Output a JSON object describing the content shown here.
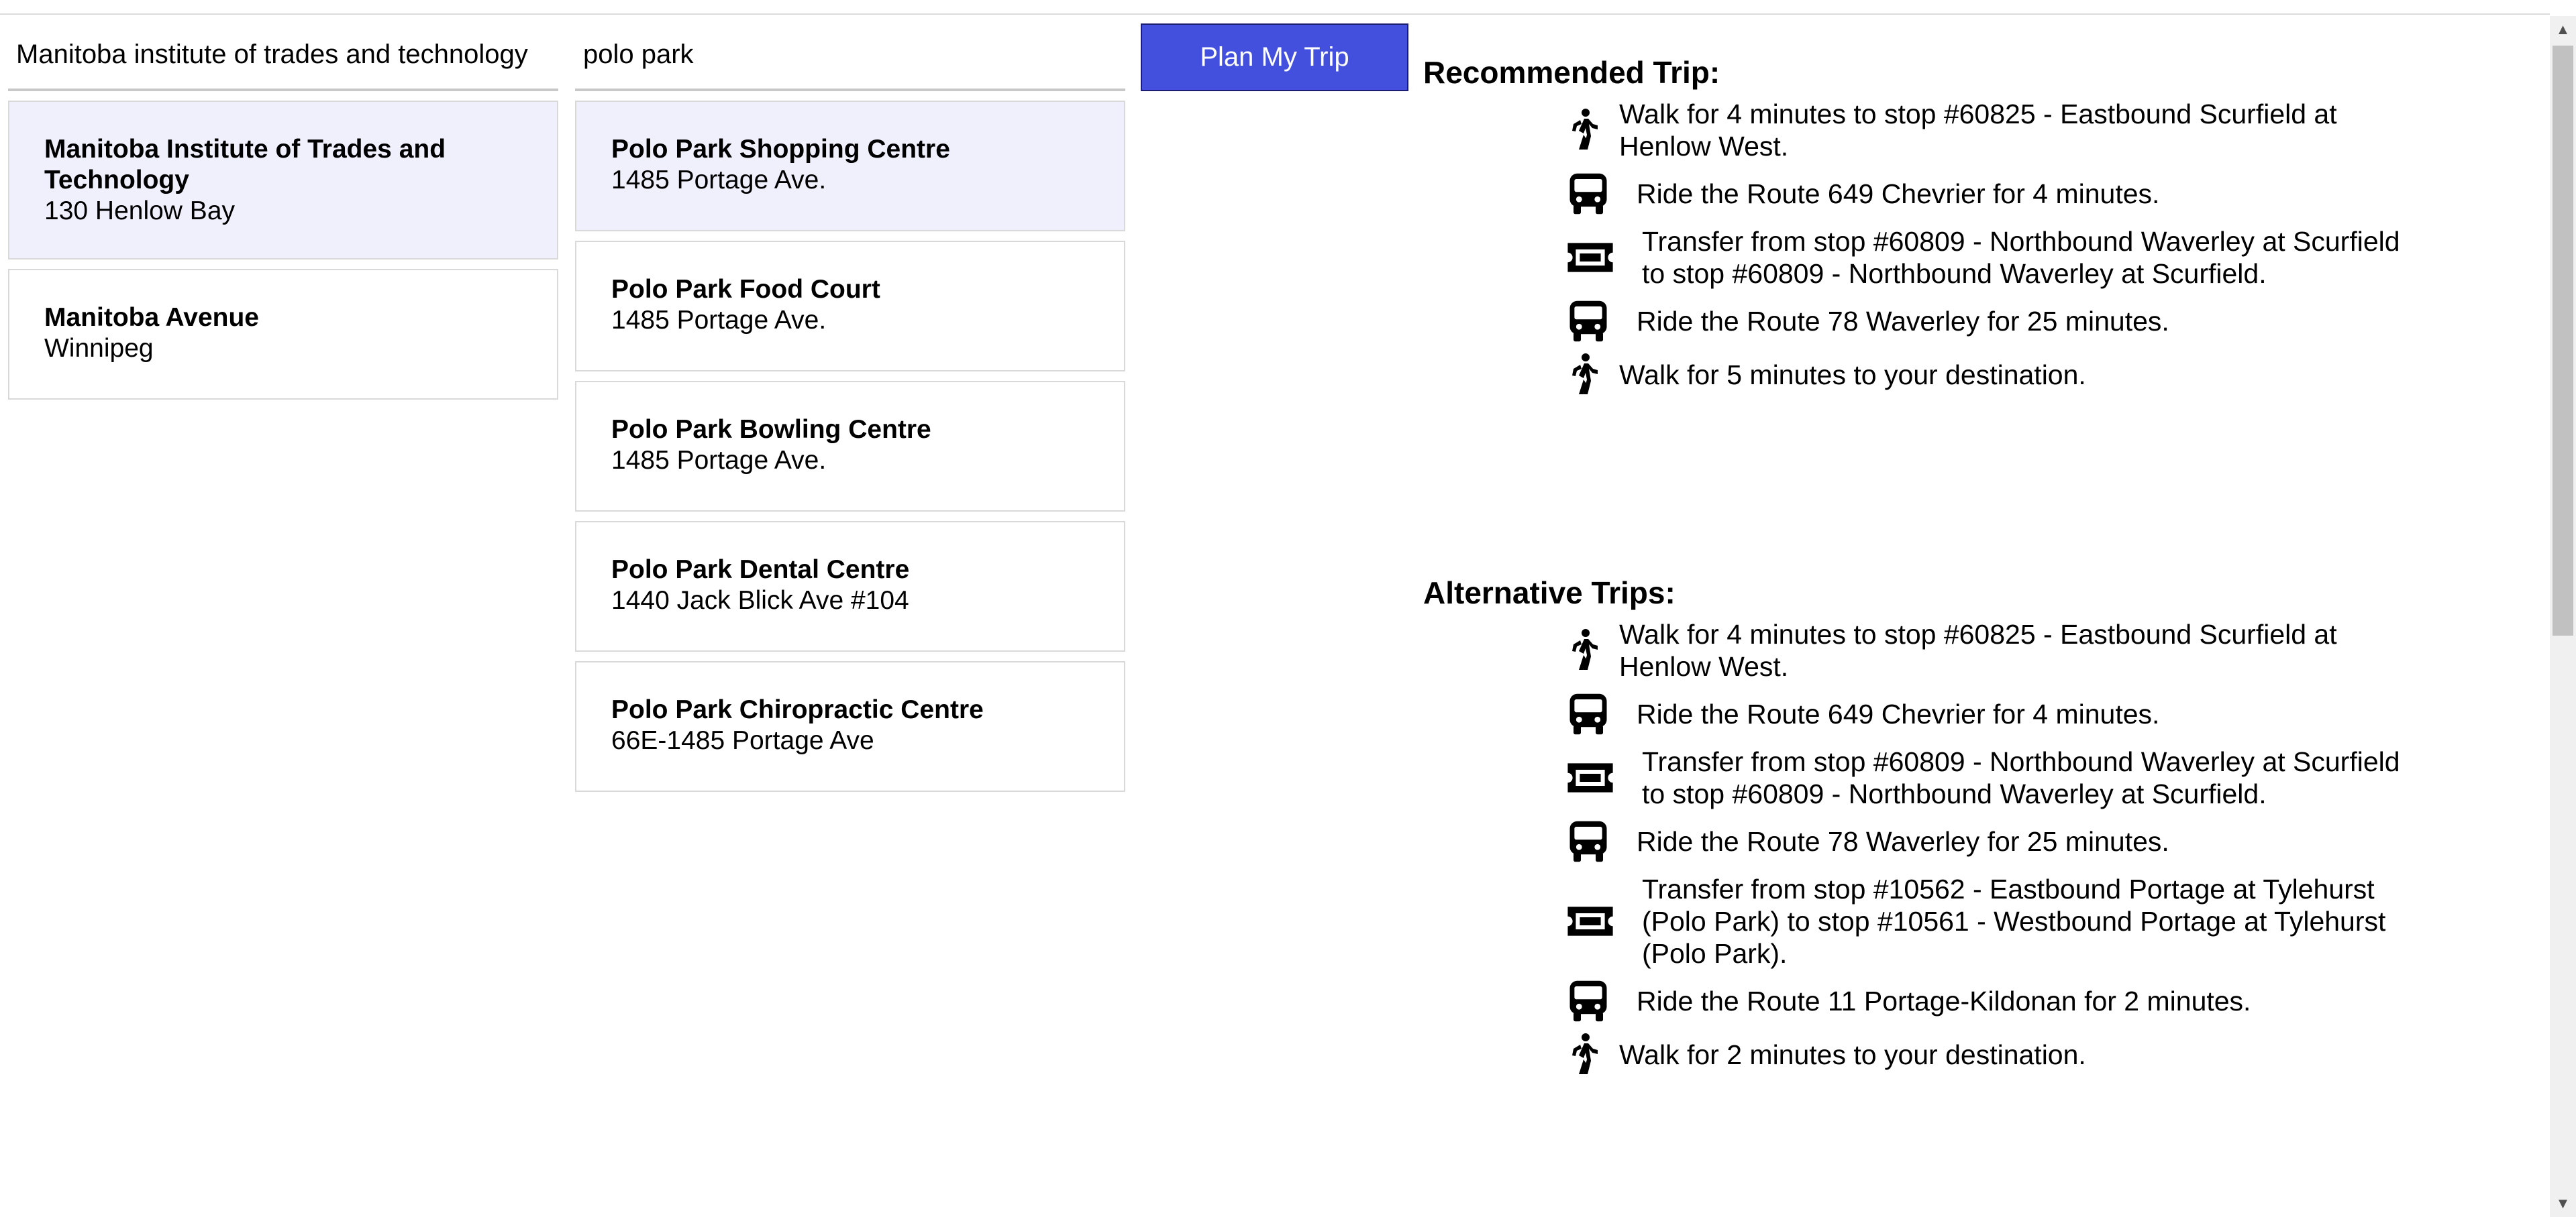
{
  "origin": {
    "query": "Manitoba institute of trades and technology",
    "results": [
      {
        "name": "Manitoba Institute of Trades and Technology",
        "address": "130 Henlow Bay"
      },
      {
        "name": "Manitoba Avenue",
        "address": "Winnipeg"
      }
    ]
  },
  "destination": {
    "query": "polo park",
    "results": [
      {
        "name": "Polo Park Shopping Centre",
        "address": "1485 Portage Ave."
      },
      {
        "name": "Polo Park Food Court",
        "address": "1485 Portage Ave."
      },
      {
        "name": "Polo Park Bowling Centre",
        "address": "1485 Portage Ave."
      },
      {
        "name": "Polo Park Dental Centre",
        "address": "1440 Jack Blick Ave #104"
      },
      {
        "name": "Polo Park Chiropractic Centre",
        "address": "66E-1485 Portage Ave"
      }
    ]
  },
  "plan_button_label": "Plan My Trip",
  "colors": {
    "accent": "#4350de",
    "selected_bg": "#eff0fc"
  },
  "recommended": {
    "heading": "Recommended Trip:",
    "steps": [
      {
        "icon": "walk-icon",
        "text": "Walk for 4 minutes to stop #60825 - Eastbound Scurfield at Henlow West."
      },
      {
        "icon": "bus-icon",
        "text": "Ride the Route 649 Chevrier for 4 minutes."
      },
      {
        "icon": "transfer-icon",
        "text": "Transfer from stop #60809 - Northbound Waverley at Scurfield to stop #60809 - Northbound Waverley at Scurfield."
      },
      {
        "icon": "bus-icon",
        "text": "Ride the Route 78 Waverley for 25 minutes."
      },
      {
        "icon": "walk-icon",
        "text": "Walk for 5 minutes to your destination."
      }
    ]
  },
  "alternatives": {
    "heading": "Alternative Trips:",
    "steps": [
      {
        "icon": "walk-icon",
        "text": "Walk for 4 minutes to stop #60825 - Eastbound Scurfield at Henlow West."
      },
      {
        "icon": "bus-icon",
        "text": "Ride the Route 649 Chevrier for 4 minutes."
      },
      {
        "icon": "transfer-icon",
        "text": "Transfer from stop #60809 - Northbound Waverley at Scurfield to stop #60809 - Northbound Waverley at Scurfield."
      },
      {
        "icon": "bus-icon",
        "text": "Ride the Route 78 Waverley for 25 minutes."
      },
      {
        "icon": "transfer-icon",
        "text": "Transfer from stop #10562 - Eastbound Portage at Tylehurst (Polo Park) to stop #10561 - Westbound Portage at Tylehurst (Polo Park)."
      },
      {
        "icon": "bus-icon",
        "text": "Ride the Route 11 Portage-Kildonan for 2 minutes."
      },
      {
        "icon": "walk-icon",
        "text": "Walk for 2 minutes to your destination."
      }
    ]
  }
}
